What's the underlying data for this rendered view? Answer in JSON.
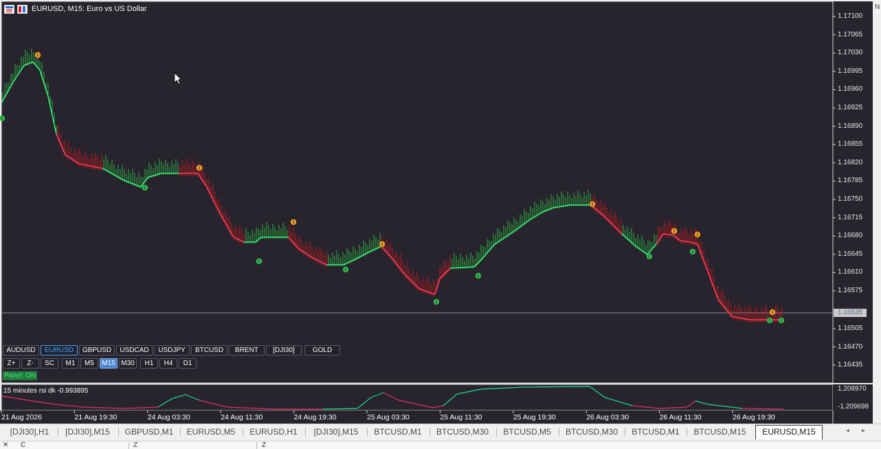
{
  "window": {
    "title": "EURUSD, M15:  Euro vs US Dollar"
  },
  "colors": {
    "background": "#27242e",
    "bull": "#2ecc40",
    "bull_line": "#39f07a",
    "bear": "#e01818",
    "bear_line": "#ff3c5a",
    "signal_up": "#2fbb4f",
    "signal_down": "#f0a020",
    "rsi_up": "#1edc8a",
    "rsi_down": "#e03060"
  },
  "price_axis": {
    "ticks": [
      "1.17100",
      "1.17065",
      "1.17030",
      "1.16995",
      "1.16960",
      "1.16925",
      "1.16890",
      "1.16855",
      "1.16820",
      "1.16785",
      "1.16750",
      "1.16715",
      "1.16680",
      "1.16645",
      "1.16610",
      "1.16575",
      "1.16535",
      "1.16505",
      "1.16470",
      "1.16435"
    ],
    "current_price": "1.16535"
  },
  "indicator": {
    "label": "15 minutes rsi dk  -0.993895",
    "max": "1.208970",
    "min": "-1.209698"
  },
  "time_axis": [
    "21 Aug 2026",
    "21 Aug 19:30",
    "24 Aug 03:30",
    "24 Aug 11:30",
    "24 Aug 19:30",
    "25 Aug 03:30",
    "25 Aug 11:30",
    "25 Aug 19:30",
    "26 Aug 03:30",
    "26 Aug 11:30",
    "26 Aug 19:30"
  ],
  "chart_data": {
    "type": "line",
    "title": "EURUSD, M15:  Euro vs US Dollar",
    "series": [
      {
        "name": "EURUSD",
        "x": [
          "21 Aug 2026",
          "21 Aug 19:30",
          "24 Aug 03:30",
          "24 Aug 11:30",
          "24 Aug 19:30",
          "25 Aug 03:30",
          "25 Aug 11:30",
          "25 Aug 19:30",
          "26 Aug 03:30",
          "26 Aug 11:30",
          "26 Aug 19:30"
        ],
        "values": [
          1.1694,
          1.1683,
          1.168,
          1.1667,
          1.1662,
          1.1664,
          1.1659,
          1.1673,
          1.1674,
          1.1666,
          1.1653
        ]
      }
    ],
    "ylim": [
      1.16435,
      1.171
    ]
  },
  "symbol_buttons": [
    {
      "label": "AUDUSD",
      "active": false
    },
    {
      "label": "EURUSD",
      "active": true
    },
    {
      "label": "GBPUSD",
      "active": false
    },
    {
      "label": "USDCAD",
      "active": false
    },
    {
      "label": "USDJPY",
      "active": false
    },
    {
      "label": "BTCUSD",
      "active": false
    },
    {
      "label": "BRENT",
      "active": false
    },
    {
      "label": "[DJI30]",
      "active": false
    },
    {
      "label": "GOLD",
      "active": false
    }
  ],
  "tool_buttons": [
    {
      "label": "Z+",
      "active": false
    },
    {
      "label": "Z-",
      "active": false
    },
    {
      "label": "SC",
      "active": false
    },
    {
      "label": "M1",
      "active": false
    },
    {
      "label": "M5",
      "active": false
    },
    {
      "label": "M15",
      "active": true
    },
    {
      "label": "M30",
      "active": false
    },
    {
      "label": "H1",
      "active": false
    },
    {
      "label": "H4",
      "active": false
    },
    {
      "label": "D1",
      "active": false
    }
  ],
  "panel_status": "Panel: ON",
  "tabs": [
    {
      "label": "[DJI30],H1",
      "active": false
    },
    {
      "label": "[DJI30],M15",
      "active": false
    },
    {
      "label": "GBPUSD,M1",
      "active": false
    },
    {
      "label": "EURUSD,M5",
      "active": false
    },
    {
      "label": "EURUSD,H1",
      "active": false
    },
    {
      "label": "[DJI30],M15",
      "active": false
    },
    {
      "label": "BTCUSD,M1",
      "active": false
    },
    {
      "label": "BTCUSD,M30",
      "active": false
    },
    {
      "label": "BTCUSD,M5",
      "active": false
    },
    {
      "label": "BTCUSD,M30",
      "active": false
    },
    {
      "label": "BTCUSD,M1",
      "active": false
    },
    {
      "label": "BTCUSD,M15",
      "active": false
    },
    {
      "label": "EURUSD,M15",
      "active": true
    }
  ],
  "tab_nav": {
    "prev": "◂",
    "next": "▸"
  },
  "bottom_bar": {
    "close": "✕",
    "col1": "Č",
    "col2": "Z",
    "col3": "Z"
  },
  "right_strip": {
    "label": "N"
  }
}
